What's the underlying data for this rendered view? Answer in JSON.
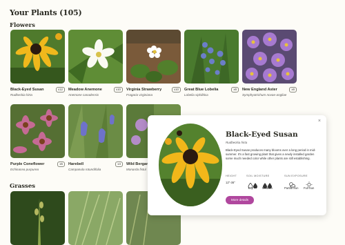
{
  "page": {
    "title": "Your Plants (105)"
  },
  "sections": {
    "flowers": "Flowers",
    "grasses": "Grasses"
  },
  "flowers": [
    {
      "name": "Black-Eyed Susan",
      "latin": "Rudbeckia hirta",
      "qty": "x12"
    },
    {
      "name": "Meadow Anemone",
      "latin": "Anemone canadensis",
      "qty": "x10"
    },
    {
      "name": "Virginia Strawberry",
      "latin": "Fragaria virginiana",
      "qty": "x10"
    },
    {
      "name": "Great Blue Lobelia",
      "latin": "Lobelia siphilitica",
      "qty": "x8"
    },
    {
      "name": "New England Aster",
      "latin": "Symphyotrichum novae-angliae",
      "qty": "x8"
    },
    {
      "name": "Purple Coneflower",
      "latin": "Echinacea purpurea",
      "qty": "x6"
    },
    {
      "name": "Harebell",
      "latin": "Campanula rotundifolia",
      "qty": "x4"
    },
    {
      "name": "Wild Bergam",
      "latin": "Monarda fistul",
      "qty": ""
    }
  ],
  "detail": {
    "title": "Black-Eyed Susan",
    "latin": "Rudbeckia hirta",
    "description": "Black-Eyed Susan produces many blooms over a long period in mid-summer. It's a fast growing plant that gives a newly installed garden some much needed color while other plants are still establishing.",
    "height_label": "HEIGHT",
    "height_value": "12\"-36\"",
    "moisture_label": "SOIL MOISTURE",
    "moisture_values": [
      "Dry",
      "Medium"
    ],
    "sun_label": "SUN EXPOSURE",
    "sun_values": [
      "Partial Sun",
      "Full Sun"
    ],
    "button": "More details",
    "close": "×"
  },
  "colors": {
    "accent": "#b0479e",
    "background": "#fdfcf7"
  }
}
